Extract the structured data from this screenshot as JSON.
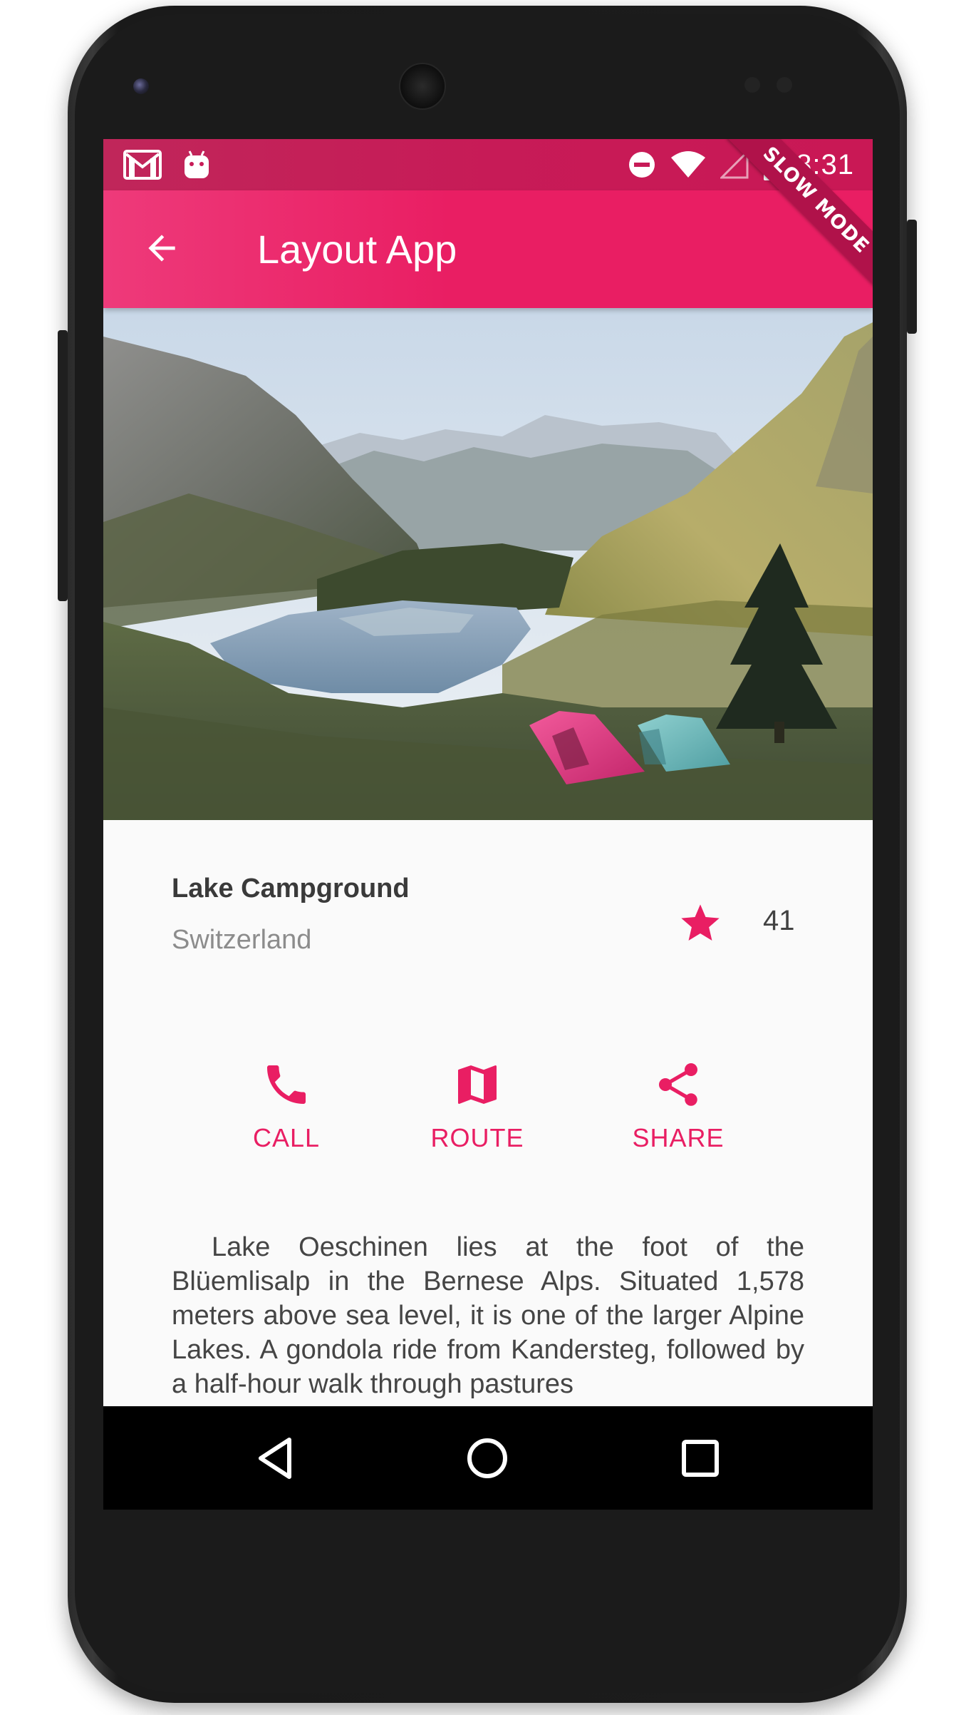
{
  "status_bar": {
    "time": "8:31",
    "left_icons": [
      "gmail-icon",
      "android-icon"
    ],
    "right_icons": [
      "do-not-disturb-icon",
      "wifi-icon",
      "no-signal-icon",
      "battery-charging-icon"
    ]
  },
  "debug_banner": {
    "label": "SLOW MODE"
  },
  "app_bar": {
    "title": "Layout App",
    "back_icon": "arrow-back-icon"
  },
  "place": {
    "name": "Lake Campground",
    "country": "Switzerland",
    "favorite_count": "41",
    "favorite_icon": "star-icon"
  },
  "actions": [
    {
      "label": "CALL",
      "icon": "phone-icon"
    },
    {
      "label": "ROUTE",
      "icon": "map-icon"
    },
    {
      "label": "SHARE",
      "icon": "share-icon"
    }
  ],
  "description": "Lake Oeschinen lies at the foot of the Blüemlisalp in the Bernese Alps. Situated 1,578 meters above sea level, it is one of the larger Alpine Lakes. A gondola ride from Kandersteg, followed by a half-hour walk through pastures",
  "nav_bar": {
    "buttons": [
      "back-triangle-icon",
      "home-circle-icon",
      "recents-square-icon"
    ]
  },
  "colors": {
    "accent": "#e91e63",
    "status_bar": "#c71b57",
    "text_primary": "#3a3a3a",
    "text_secondary": "#8c8c8c"
  }
}
